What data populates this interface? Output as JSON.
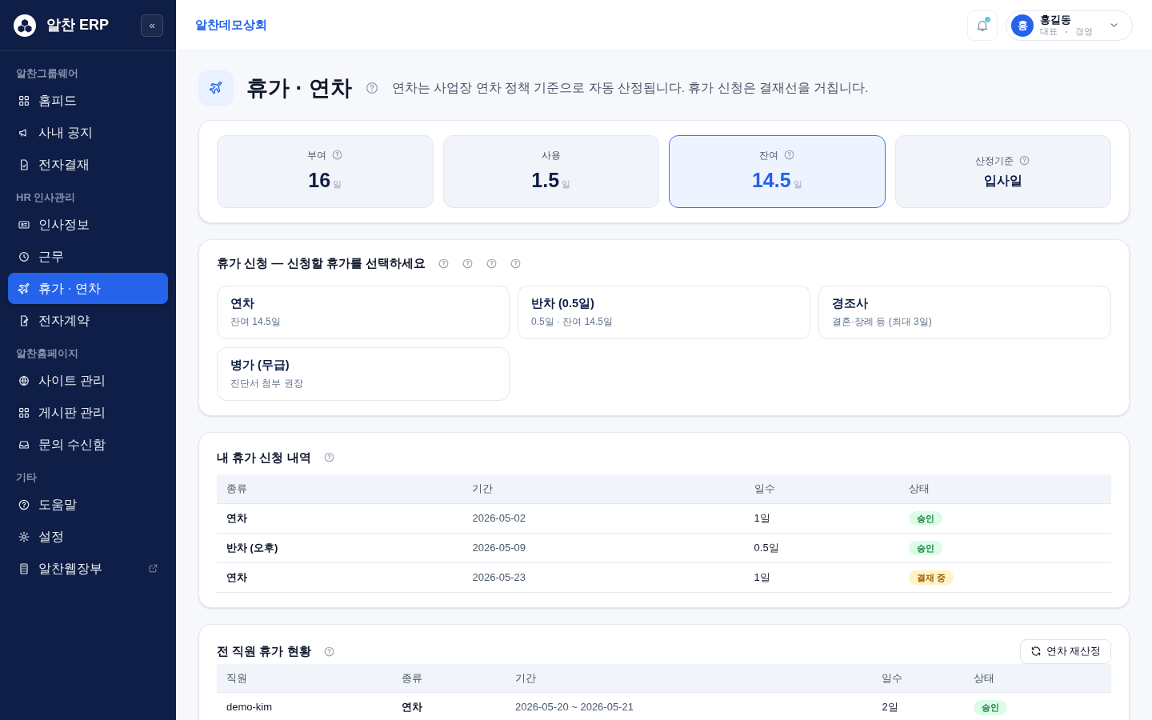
{
  "sidebar": {
    "brand": "알찬 ERP",
    "collapse": "«",
    "sections": [
      {
        "title": "알찬그룹웨어",
        "items": [
          {
            "label": "홈피드",
            "selected": false,
            "external": false
          },
          {
            "label": "사내 공지",
            "selected": false,
            "external": false
          },
          {
            "label": "전자결재",
            "selected": false,
            "external": false
          }
        ]
      },
      {
        "title": "HR 인사관리",
        "items": [
          {
            "label": "인사정보",
            "selected": false,
            "external": false
          },
          {
            "label": "근무",
            "selected": false,
            "external": false
          },
          {
            "label": "휴가 · 연차",
            "selected": true,
            "external": false
          },
          {
            "label": "전자계약",
            "selected": false,
            "external": false
          }
        ]
      },
      {
        "title": "알찬홈페이지",
        "items": [
          {
            "label": "사이트 관리",
            "selected": false,
            "external": false
          },
          {
            "label": "게시판 관리",
            "selected": false,
            "external": false
          },
          {
            "label": "문의 수신함",
            "selected": false,
            "external": false
          }
        ]
      },
      {
        "title": "기타",
        "items": [
          {
            "label": "도움말",
            "selected": false,
            "external": false
          },
          {
            "label": "설정",
            "selected": false,
            "external": false
          },
          {
            "label": "알찬웹장부",
            "selected": false,
            "external": true
          }
        ]
      }
    ]
  },
  "topbar": {
    "company": "알찬데모상회",
    "notification_unread": true,
    "user": {
      "avatar": "홍",
      "name": "홍길동",
      "role": "대표",
      "dept": "경영"
    }
  },
  "page": {
    "title": "휴가 · 연차",
    "description": "연차는 사업장 연차 정책 기준으로 자동 산정됩니다. 휴가 신청은 결재선을 거칩니다."
  },
  "stats": [
    {
      "label": "부여",
      "value": "16",
      "unit": "일",
      "help": true,
      "selected": false
    },
    {
      "label": "사용",
      "value": "1.5",
      "unit": "일",
      "help": false,
      "selected": false
    },
    {
      "label": "잔여",
      "value": "14.5",
      "unit": "일",
      "help": true,
      "selected": true
    },
    {
      "label": "산정기준",
      "value": "입사일",
      "help": true,
      "selected": false
    }
  ],
  "request": {
    "title": "휴가 신청 — 신청할 휴가를 선택하세요",
    "options": [
      {
        "name": "연차",
        "detail": "잔여 14.5일"
      },
      {
        "name": "반차 (0.5일)",
        "detail": "0.5일 · 잔여 14.5일"
      },
      {
        "name": "경조사",
        "detail": "결혼·장례 등 (최대 3일)"
      },
      {
        "name": "병가 (무급)",
        "detail": "진단서 첨부 권장"
      }
    ]
  },
  "my_requests": {
    "title": "내 휴가 신청 내역",
    "columns": [
      "종류",
      "기간",
      "일수",
      "상태"
    ],
    "rows": [
      {
        "type": "연차",
        "period": "2026-05-02",
        "days": "1일",
        "status": {
          "text": "승인",
          "kind": "approved"
        }
      },
      {
        "type": "반차 (오후)",
        "period": "2026-05-09",
        "days": "0.5일",
        "status": {
          "text": "승인",
          "kind": "approved"
        }
      },
      {
        "type": "연차",
        "period": "2026-05-23",
        "days": "1일",
        "status": {
          "text": "결재 중",
          "kind": "pending"
        }
      }
    ]
  },
  "all_staff": {
    "title": "전 직원 휴가 현황",
    "button": "연차 재산정",
    "columns": [
      "직원",
      "종류",
      "기간",
      "일수",
      "상태"
    ],
    "rows": [
      {
        "employee": "demo-kim",
        "type": "연차",
        "period": "2026-05-20 ~ 2026-05-21",
        "days": "2일",
        "status": {
          "text": "승인",
          "kind": "approved"
        }
      }
    ]
  }
}
